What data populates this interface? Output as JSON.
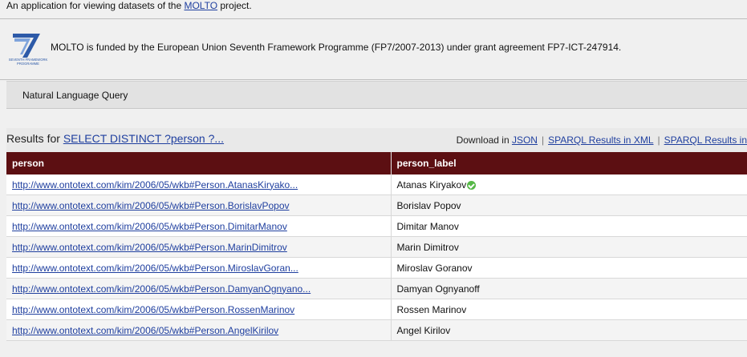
{
  "header": {
    "intro_text": "An application for viewing datasets of the ",
    "molto_link": "MOLTO",
    "intro_suffix": " project."
  },
  "funding": {
    "logo_text_line1": "SEVENTH FRAMEWORK",
    "logo_text_line2": "PROGRAMME",
    "text": "MOLTO is funded by the European Union Seventh Framework Programme (FP7/2007-2013) under grant agreement FP7-ICT-247914."
  },
  "nlq": {
    "label": "Natural Language Query"
  },
  "results": {
    "prefix": "Results for ",
    "query_link": "SELECT DISTINCT ?person ?...",
    "download_label": "Download in ",
    "downloads": [
      "JSON",
      "SPARQL Results in XML",
      "SPARQL Results in"
    ],
    "columns": [
      "person",
      "person_label"
    ],
    "rows": [
      {
        "uri": "http://www.ontotext.com/kim/2006/05/wkb#Person.AtanasKiryako...",
        "label": "Atanas Kiryakov"
      },
      {
        "uri": "http://www.ontotext.com/kim/2006/05/wkb#Person.BorislavPopov",
        "label": "Borislav Popov"
      },
      {
        "uri": "http://www.ontotext.com/kim/2006/05/wkb#Person.DimitarManov",
        "label": "Dimitar Manov"
      },
      {
        "uri": "http://www.ontotext.com/kim/2006/05/wkb#Person.MarinDimitrov",
        "label": "Marin Dimitrov"
      },
      {
        "uri": "http://www.ontotext.com/kim/2006/05/wkb#Person.MiroslavGoran...",
        "label": "Miroslav Goranov"
      },
      {
        "uri": "http://www.ontotext.com/kim/2006/05/wkb#Person.DamyanOgnyano...",
        "label": "Damyan Ognyanoff"
      },
      {
        "uri": "http://www.ontotext.com/kim/2006/05/wkb#Person.RossenMarinov",
        "label": "Rossen Marinov"
      },
      {
        "uri": "http://www.ontotext.com/kim/2006/05/wkb#Person.AngelKirilov",
        "label": "Angel Kirilov"
      }
    ]
  },
  "colors": {
    "header_bg": "#5c0f12",
    "link": "#1f3f9f",
    "ok_icon": "#56b847"
  }
}
